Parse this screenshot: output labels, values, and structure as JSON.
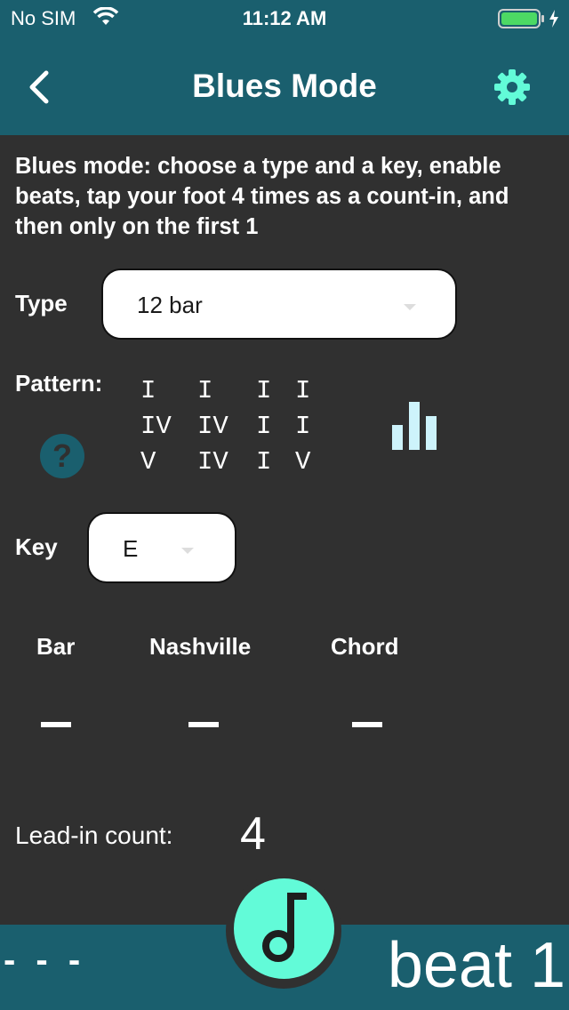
{
  "status": {
    "carrier": "No SIM",
    "time": "11:12 AM"
  },
  "header": {
    "title": "Blues Mode"
  },
  "description": "Blues mode: choose a type and a key, enable beats, tap your foot 4 times as a count-in, and then only on the first 1",
  "type": {
    "label": "Type",
    "value": "12 bar"
  },
  "pattern": {
    "label": "Pattern:",
    "help_symbol": "?",
    "rows": [
      [
        "I",
        "I",
        "I",
        "I"
      ],
      [
        "IV",
        "IV",
        "I",
        "I"
      ],
      [
        "V",
        "IV",
        "I",
        "V"
      ]
    ]
  },
  "key": {
    "label": "Key",
    "value": "E"
  },
  "columns": {
    "bar": {
      "label": "Bar",
      "value": "–"
    },
    "nashville": {
      "label": "Nashville",
      "value": "–"
    },
    "chord": {
      "label": "Chord",
      "value": "–"
    }
  },
  "lead_in": {
    "label": "Lead-in count:",
    "value": "4"
  },
  "bottom": {
    "left_text": "- - -",
    "right_text": "beat 1"
  },
  "colors": {
    "bar": "#1a5f6e",
    "background": "#303030",
    "accent": "#62fbd8",
    "chart_icon": "#cdf3fb"
  },
  "icons": [
    "back-arrow-icon",
    "gear-icon",
    "help-icon",
    "bar-chart-icon",
    "music-note-icon",
    "wifi-icon",
    "battery-icon",
    "charging-bolt-icon"
  ]
}
